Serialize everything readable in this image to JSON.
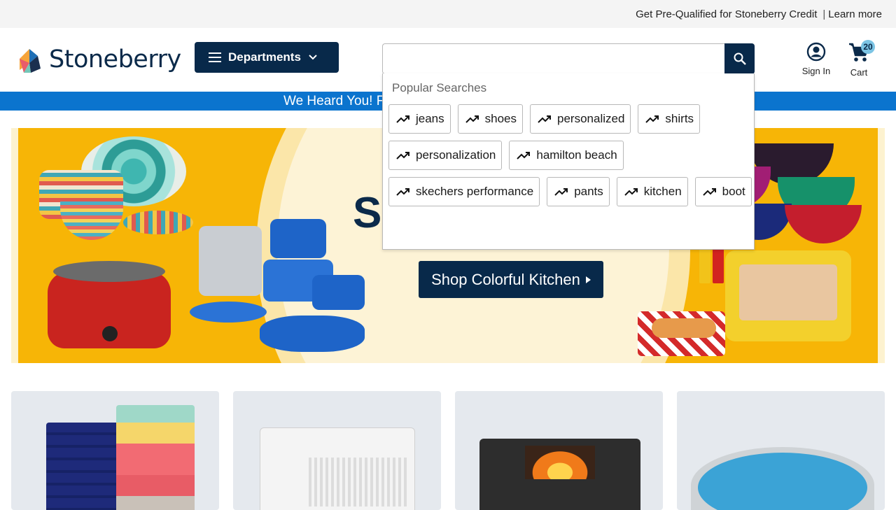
{
  "topbar": {
    "prequal_text": "Get Pre-Qualified for Stoneberry Credit",
    "separator": "|",
    "learn_more": "Learn more"
  },
  "header": {
    "logo_text": "Stoneberry",
    "departments_label": "Departments",
    "search": {
      "value": "",
      "placeholder": ""
    },
    "sign_in_label": "Sign In",
    "cart_label": "Cart",
    "cart_count": "20"
  },
  "banner": {
    "text": "We Heard You! F"
  },
  "hero": {
    "title_partial": "S",
    "cta_label": "Shop Colorful Kitchen"
  },
  "search_dropdown": {
    "title": "Popular Searches",
    "items": [
      {
        "label": "jeans"
      },
      {
        "label": "shoes"
      },
      {
        "label": "personalized"
      },
      {
        "label": "shirts"
      },
      {
        "label": "personalization"
      },
      {
        "label": "hamilton beach"
      },
      {
        "label": "skechers performance"
      },
      {
        "label": "pants"
      },
      {
        "label": "kitchen"
      },
      {
        "label": "boot"
      }
    ]
  },
  "colors": {
    "navy": "#08294a",
    "blue_banner": "#0b74ce",
    "hero_yellow": "#f7b506",
    "cart_badge": "#7cc4e4"
  },
  "icons": [
    "menu-icon",
    "chevron-down-icon",
    "search-icon",
    "account-icon",
    "cart-icon",
    "trending-icon",
    "caret-right-icon"
  ]
}
